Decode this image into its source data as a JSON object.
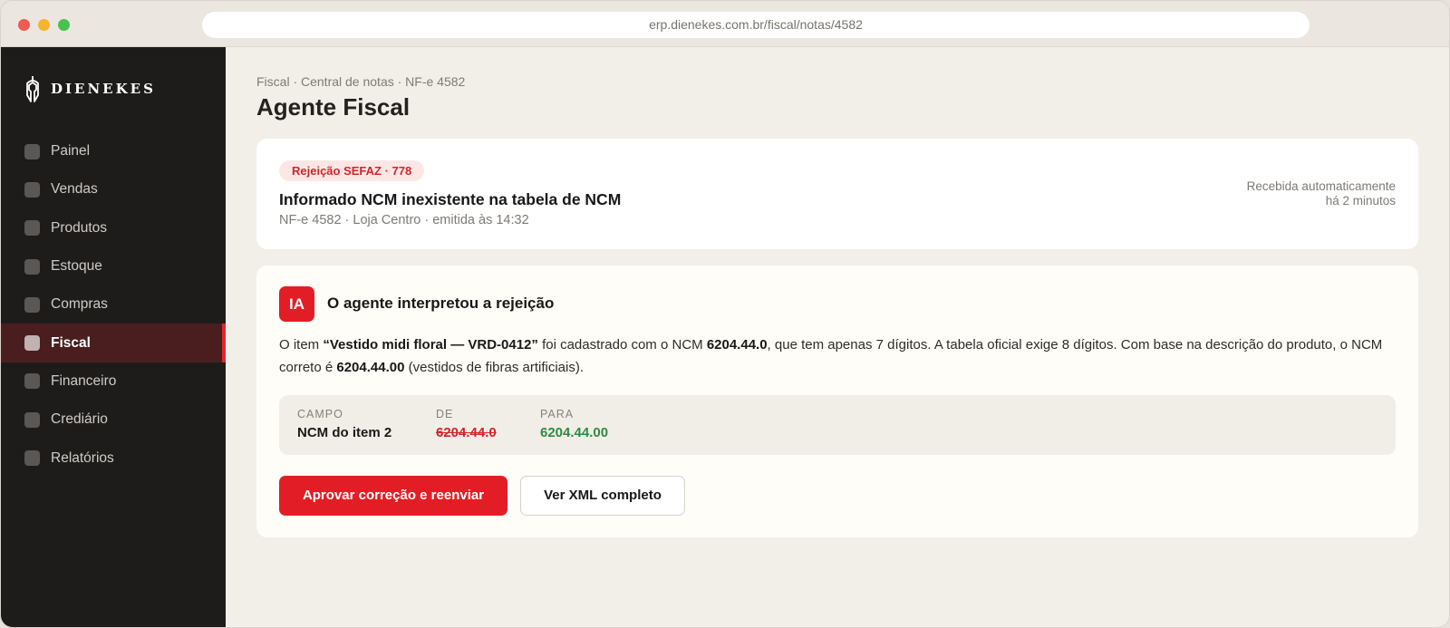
{
  "browser": {
    "url": "erp.dienekes.com.br/fiscal/notas/4582"
  },
  "sidebar": {
    "logo_text": "DIENEKES",
    "items": [
      {
        "label": "Painel",
        "active": false
      },
      {
        "label": "Vendas",
        "active": false
      },
      {
        "label": "Produtos",
        "active": false
      },
      {
        "label": "Estoque",
        "active": false
      },
      {
        "label": "Compras",
        "active": false
      },
      {
        "label": "Fiscal",
        "active": true
      },
      {
        "label": "Financeiro",
        "active": false
      },
      {
        "label": "Crediário",
        "active": false
      },
      {
        "label": "Relatórios",
        "active": false
      }
    ]
  },
  "header": {
    "breadcrumb": "Fiscal · Central de notas · NF-e 4582",
    "title": "Agente Fiscal"
  },
  "rejection": {
    "badge": "Rejeição SEFAZ · 778",
    "title": "Informado NCM inexistente na tabela de NCM",
    "meta": "NF-e 4582 · Loja Centro · emitida às 14:32",
    "received_line1": "Recebida automaticamente",
    "received_line2": "há 2 minutos"
  },
  "agent": {
    "badge": "IA",
    "title": "O agente interpretou a rejeição",
    "explanation": {
      "t1": "O item ",
      "item": "“Vestido midi floral — VRD-0412”",
      "t2": " foi cadastrado com o NCM ",
      "ncm_old": "6204.44.0",
      "t3": ", que tem apenas 7 dígitos. A tabela oficial exige 8 dígitos. Com base na descrição do produto, o NCM correto é ",
      "ncm_new": "6204.44.00",
      "t4": " (vestidos de fibras artificiais)."
    },
    "diff": {
      "field_label": "CAMPO",
      "field_value": "NCM do item 2",
      "from_label": "DE",
      "from_value": "6204.44.0",
      "to_label": "PARA",
      "to_value": "6204.44.00"
    },
    "approve_label": "Aprovar correção e reenviar",
    "view_xml_label": "Ver XML completo"
  },
  "colors": {
    "accent": "#e31d25",
    "sidebar_bg": "#1e1c1b",
    "active_item_bg": "#4a1e1f",
    "success": "#2e8b3e"
  }
}
